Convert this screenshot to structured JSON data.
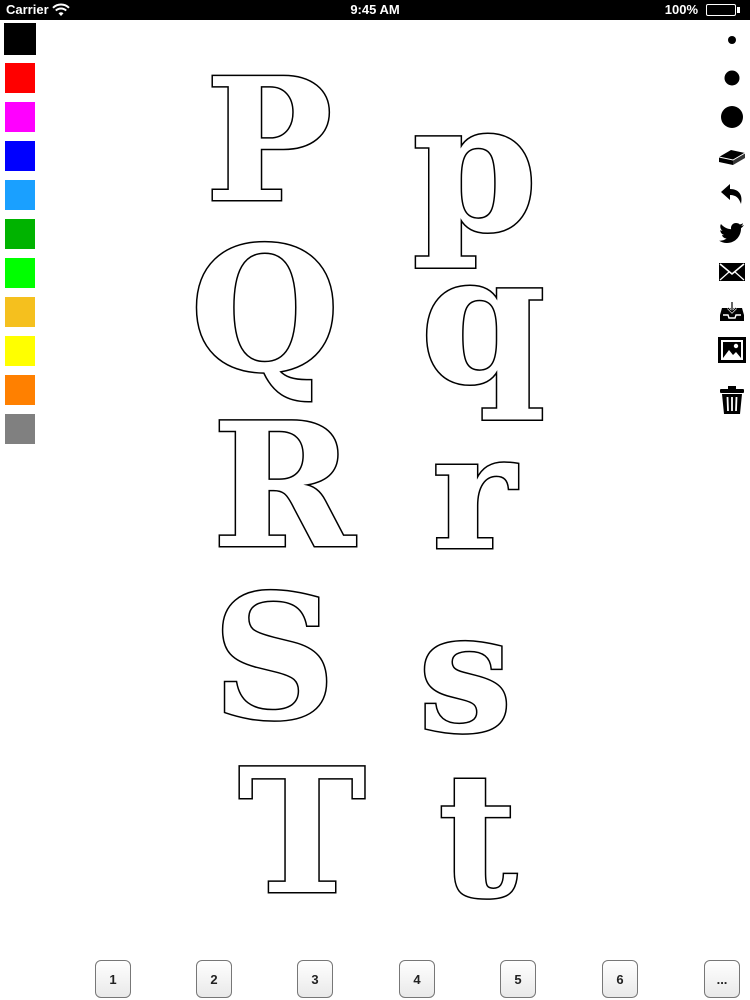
{
  "status_bar": {
    "carrier": "Carrier",
    "time": "9:45 AM",
    "battery": "100%"
  },
  "palette": {
    "colors": [
      {
        "name": "black",
        "hex": "#000000"
      },
      {
        "name": "red",
        "hex": "#ff0000"
      },
      {
        "name": "magenta",
        "hex": "#ff00ff"
      },
      {
        "name": "blue",
        "hex": "#0000ff"
      },
      {
        "name": "sky-blue",
        "hex": "#1aa0ff"
      },
      {
        "name": "green",
        "hex": "#00b300"
      },
      {
        "name": "lime",
        "hex": "#00ff00"
      },
      {
        "name": "gold",
        "hex": "#f5c01e"
      },
      {
        "name": "yellow",
        "hex": "#ffff00"
      },
      {
        "name": "orange",
        "hex": "#ff8000"
      },
      {
        "name": "gray",
        "hex": "#808080"
      }
    ],
    "selected_index": 0
  },
  "toolbar": {
    "tools": [
      "brush-small-icon",
      "brush-medium-icon",
      "brush-large-icon",
      "eraser-icon",
      "undo-icon",
      "twitter-icon",
      "mail-icon",
      "save-tray-icon",
      "image-icon",
      "trash-icon"
    ]
  },
  "letters": [
    {
      "upper": "P",
      "lower": "p"
    },
    {
      "upper": "Q",
      "lower": "q"
    },
    {
      "upper": "R",
      "lower": "r"
    },
    {
      "upper": "S",
      "lower": "s"
    },
    {
      "upper": "T",
      "lower": "t"
    }
  ],
  "pages": [
    "1",
    "2",
    "3",
    "4",
    "5",
    "6",
    "..."
  ]
}
